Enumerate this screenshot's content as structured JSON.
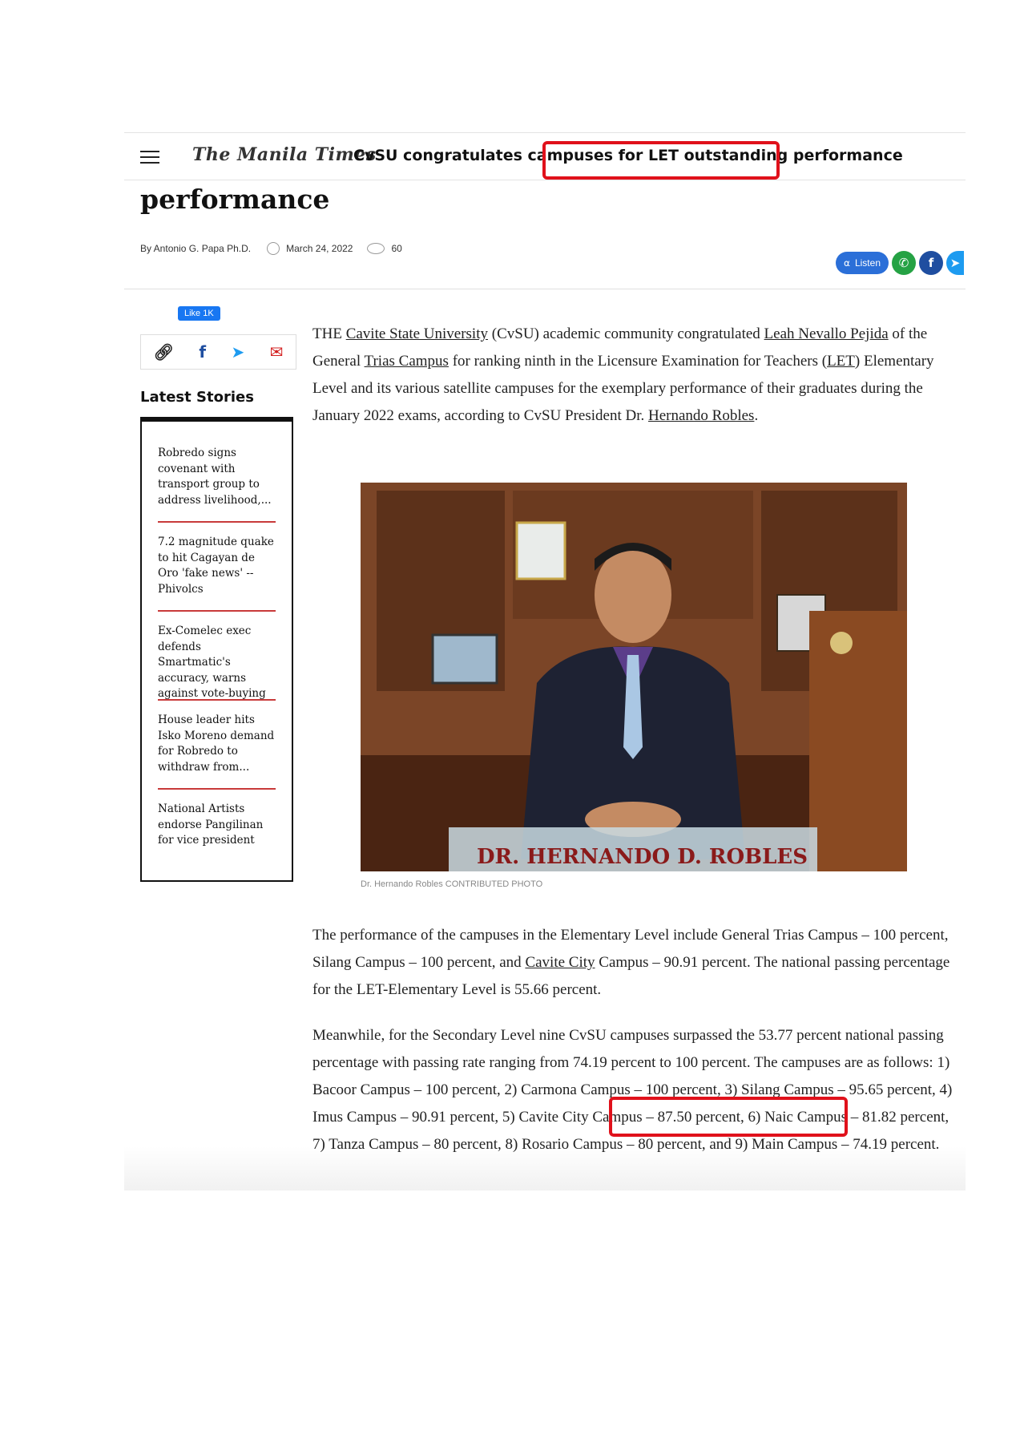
{
  "topbar": {
    "site_name": "The Manila Times",
    "article_title": "CvSU congratulates campuses for LET outstanding performance"
  },
  "headline_tail": "performance",
  "byline": {
    "author": "By Antonio G. Papa Ph.D.",
    "date": "March 24, 2022",
    "views": "60"
  },
  "share": {
    "listen_label": "Listen",
    "like_label": "Like 1K"
  },
  "sidebar": {
    "latest_title": "Latest Stories",
    "stories": [
      "Robredo signs covenant with transport group to address livelihood,...",
      "7.2 magnitude quake to hit Cagayan de Oro 'fake news' -- Phivolcs",
      "Ex-Comelec exec defends Smartmatic's accuracy, warns against vote-buying",
      "House leader hits Isko Moreno demand for Robredo to withdraw from...",
      "National Artists endorse Pangilinan for vice president"
    ]
  },
  "article": {
    "p1": {
      "t1": "THE ",
      "l1": "Cavite State University",
      "t2": " (CvSU) academic community congratulated ",
      "l2": "Leah Nevallo Pejida",
      "t3": " of the General ",
      "l3": "Trias Campus",
      "t4": " for ranking ninth in the Licensure Examination for Teachers (",
      "l4": "LET",
      "t5": ") Elementary Level and its various satellite campuses for the exemplary performance of their graduates during the January 2022 exams, according to CvSU President Dr. ",
      "l5": "Hernando Robles",
      "t6": "."
    },
    "photo_nameplate": "DR. HERNANDO D. ROBLES",
    "caption": "Dr. Hernando Robles CONTRIBUTED PHOTO",
    "p2": {
      "t1": "The performance of the campuses in the Elementary Level include General Trias Campus – 100 percent, Silang Campus – 100 percent, and ",
      "l1": "Cavite City",
      "t2": " Campus – 90.91 percent. The national passing percentage for the LET-Elementary Level is 55.66 percent."
    },
    "p3": "Meanwhile, for the Secondary Level nine CvSU campuses surpassed the 53.77 percent national passing percentage with passing rate ranging from 74.19 percent to 100 percent. The campuses are as follows: 1) Bacoor Campus – 100 percent, 2) Carmona Campus – 100 percent, 3) Silang Campus – 95.65 percent, 4) Imus Campus – 90.91 percent, 5) Cavite City Campus – 87.50 percent, 6) Naic Campus – 81.82 percent, 7) Tanza Campus – 80 percent, 8) Rosario Campus – 80 percent, and 9) Main Campus – 74.19 percent."
  },
  "colors": {
    "highlight": "#e0111b",
    "story_divider": "#c83a3a",
    "listen_blue": "#2b6fd8"
  }
}
